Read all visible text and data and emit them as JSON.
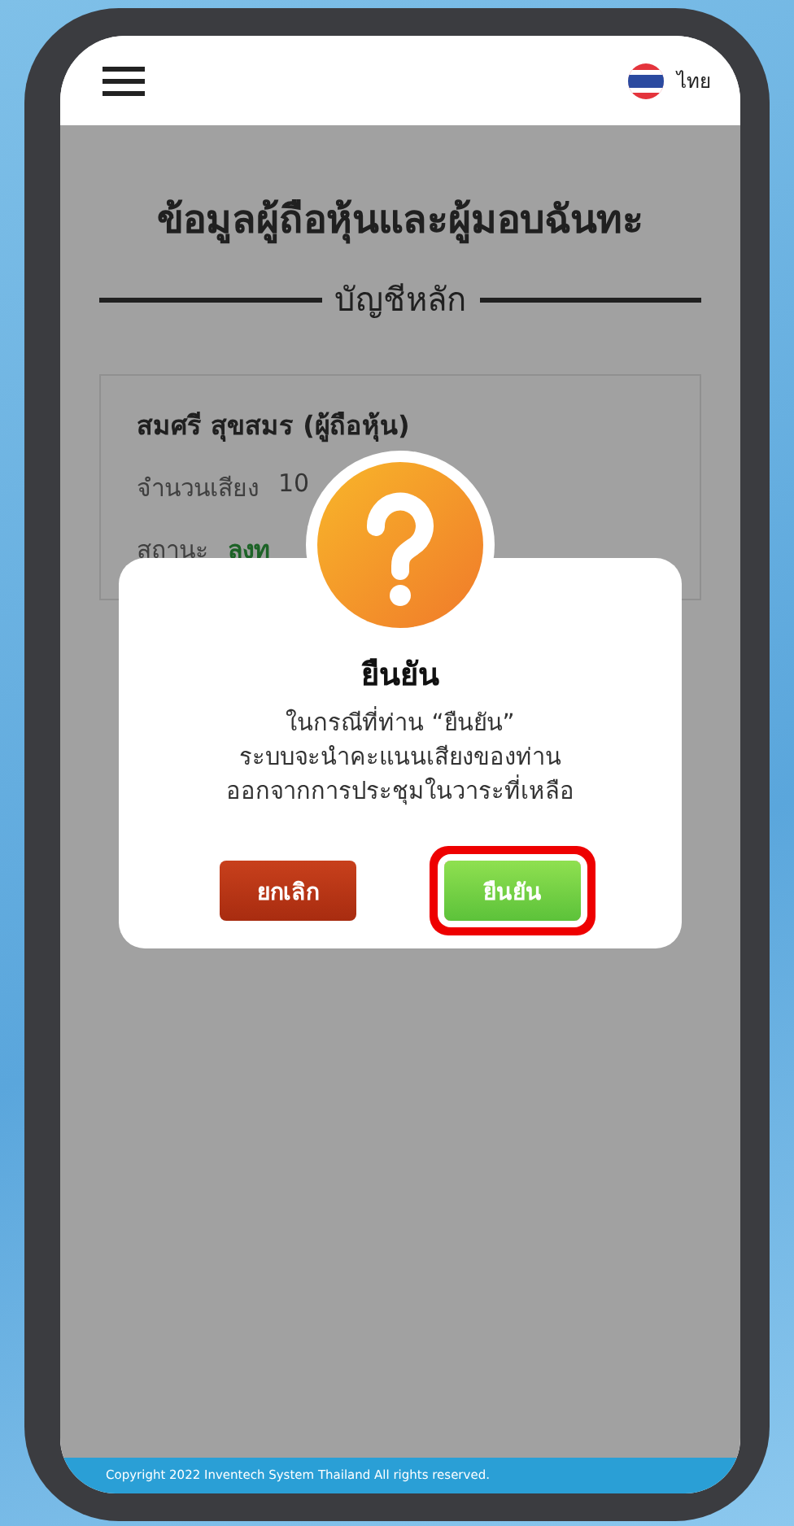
{
  "header": {
    "language": "ไทย"
  },
  "page": {
    "title": "ข้อมูลผู้ถือหุ้นและผู้มอบฉันทะ",
    "section": "บัญชีหลัก",
    "card": {
      "name": "สมศรี สุขสมร (ผู้ถือหุ้น)",
      "rows": [
        {
          "label": "จำนวนเสียง",
          "value": "10",
          "kind": "plain"
        },
        {
          "label": "สถานะ",
          "value": "ลงท",
          "kind": "status"
        }
      ]
    }
  },
  "dialog": {
    "title": "ยืนยัน",
    "message": [
      "ในกรณีที่ท่าน “ยืนยัน”",
      "ระบบจะนำคะแนนเสียงของท่าน",
      "ออกจากการประชุมในวาระที่เหลือ"
    ],
    "buttons": [
      {
        "label": "ยกเลิก",
        "kind": "cancel",
        "highlighted": false
      },
      {
        "label": "ยืนยัน",
        "kind": "confirm",
        "highlighted": true
      }
    ]
  },
  "footer": "Copyright  2022 Inventech System Thailand All rights reserved."
}
